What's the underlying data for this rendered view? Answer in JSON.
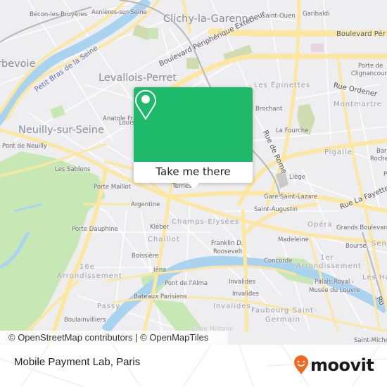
{
  "map": {
    "colors": {
      "background": "#eeeef0",
      "road": "#fbe7a1",
      "water": "#aad3f0",
      "park": "#c7e8b4",
      "popup_green": "#1eb96a"
    },
    "labels": {
      "cities": [
        "Clichy-la-Garenne",
        "Levallois-Perret",
        "Neuilly-sur-Seine",
        "rbevoie"
      ],
      "places": [
        "Bécon-les-Bruyères",
        "Asnières-sur-Seine",
        "Saint-Ouen",
        "Garibaldi",
        "Porte de",
        "Clignancourt",
        "Anatole Fra",
        "Louis",
        "Pont de Neuilly",
        "Les Sablons",
        "Porte Maillot",
        "Brochant",
        "La Fourche",
        "Liège",
        "Gare Saint-Lazare",
        "Saint-Augustin",
        "Argentine",
        "Kléber",
        "Porte Dauphine",
        "Franklin D.",
        "Roosevelt",
        "Boissière",
        "Madeleine",
        "Concorde",
        "Grands Boulevard",
        "Bourse",
        "Palais Royal -",
        "Musée du Louvre",
        "Iéna",
        "Pont de l'Alma",
        "Invalides",
        "Invalides",
        "Bateaux Parisiens",
        "Boulainvilliers",
        "Saint-Michel",
        "Ternes",
        "Ecole Militaire",
        "Bar",
        "Roche",
        "P"
      ],
      "districts": [
        "Les Épinettes",
        "Montmartre",
        "Pigalle",
        "Champs-Elysées",
        "Chaillot",
        "16e",
        "Arrondissement",
        "Opéra",
        "1er",
        "Arrondissement",
        "Passy",
        "Invalides",
        "Faubourg Saint-",
        "Germain",
        "Les Ha",
        "Sent"
      ],
      "streets": [
        "Boulevard Pér",
        "Boulevard Périphérique Extérieur",
        "Rue Ordener",
        "Rue de Rome",
        "Rue La Fayette",
        "Ru"
      ],
      "water": [
        "Petit Bras de la Seine"
      ]
    },
    "attribution": "© OpenStreetMap contributors | © OpenMapTiles"
  },
  "popup": {
    "icon": "location-pin-icon",
    "button_label": "Take me there"
  },
  "footer": {
    "title": "Mobile Payment Lab, Paris",
    "brand": "moovit",
    "brand_icon": "moovit-smiley-pin-icon",
    "brand_color": "#f26722"
  }
}
